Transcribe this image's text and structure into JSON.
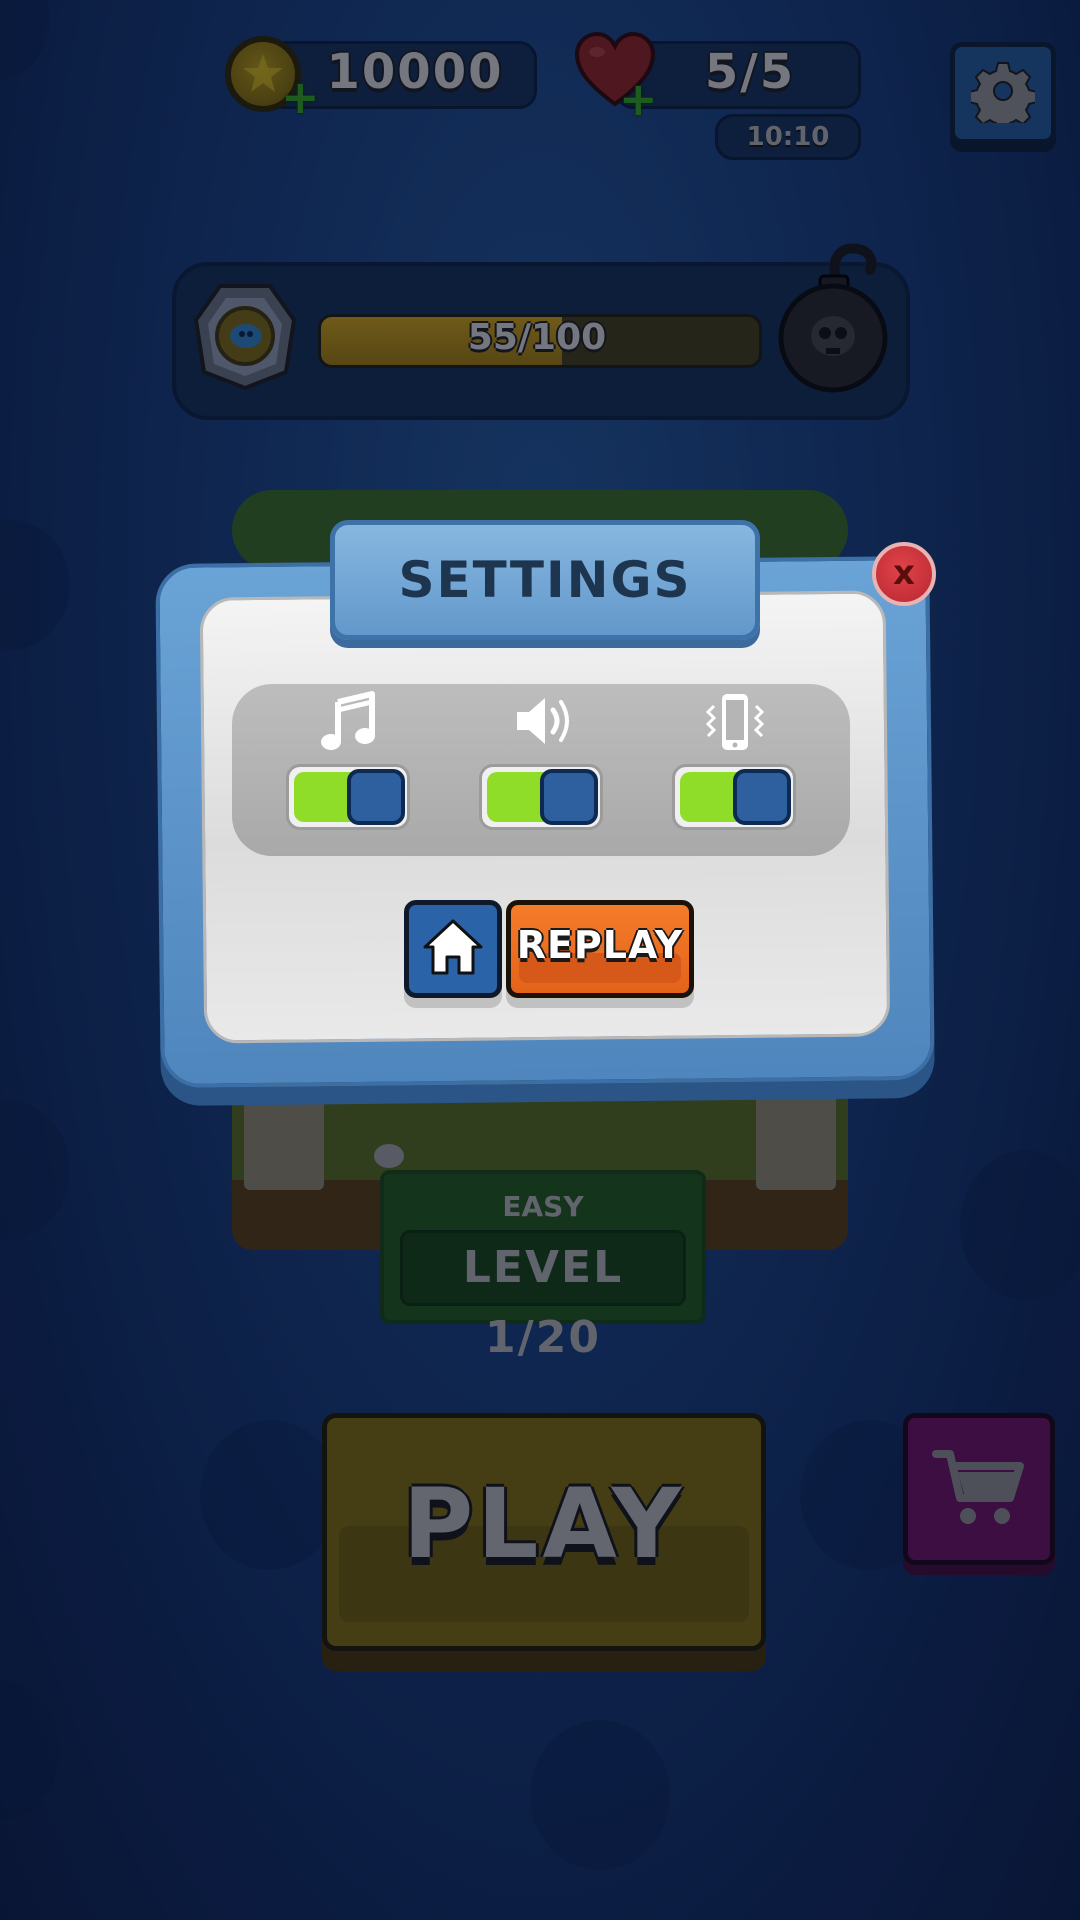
{
  "header": {
    "coins": "10000",
    "lives": "5/5",
    "life_timer": "10:10",
    "icons": [
      "coin-icon",
      "heart-icon",
      "plus-icon",
      "gear-icon"
    ]
  },
  "progress": {
    "text": "55/100",
    "value": 55,
    "max": 100,
    "icons": [
      "medal-icon",
      "bomb-icon"
    ]
  },
  "level": {
    "difficulty": "EASY",
    "label": "LEVEL 1/20"
  },
  "play": {
    "label": "PLAY"
  },
  "shop": {
    "icon": "cart-icon"
  },
  "settings_modal": {
    "title": "SETTINGS",
    "close_label": "x",
    "toggles": [
      {
        "name": "music",
        "icon": "music-note-icon",
        "on": true
      },
      {
        "name": "sound",
        "icon": "speaker-icon",
        "on": true
      },
      {
        "name": "vibration",
        "icon": "vibration-phone-icon",
        "on": true
      }
    ],
    "home_icon": "home-icon",
    "replay_label": "REPLAY"
  },
  "colors": {
    "toggle_on": "#8fdc29",
    "knob": "#2e5f9f",
    "replay": "#f47c2a",
    "modal_frame": "#5b93c8",
    "close": "#c92f37"
  }
}
